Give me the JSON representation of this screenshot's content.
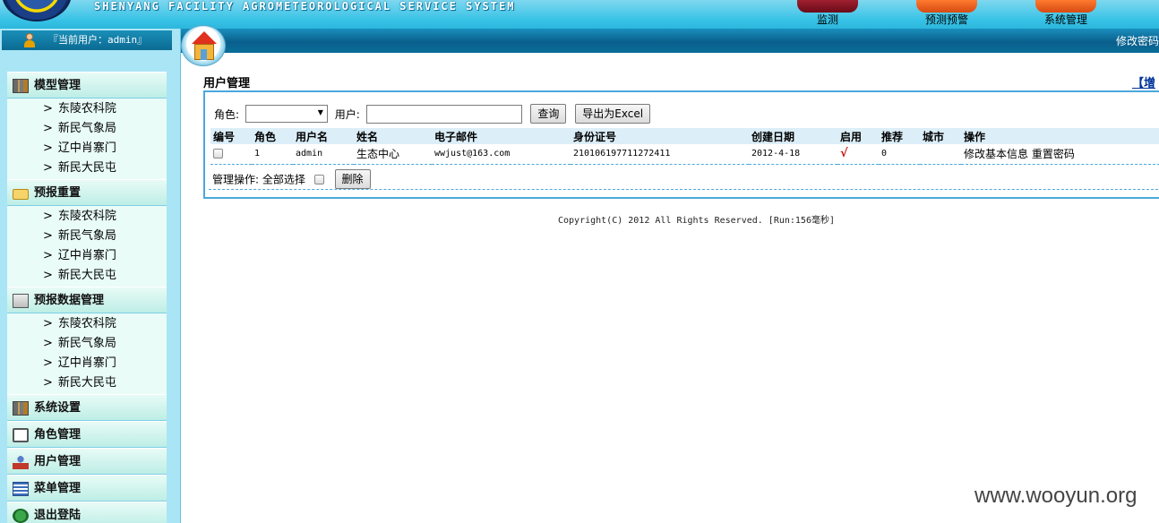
{
  "header": {
    "system_title": "SHENYANG FACILITY AGROMETEOROLOGICAL SERVICE SYSTEM",
    "nav": [
      {
        "label": "监测"
      },
      {
        "label": "预测预警"
      },
      {
        "label": "系统管理"
      }
    ]
  },
  "sidebar": {
    "current_user": "『当前用户：admin』",
    "groups": [
      {
        "title": "模型管理",
        "icon": "tools-icon",
        "items": [
          "东陵农科院",
          "新民气象局",
          "辽中肖寨门",
          "新民大民屯"
        ]
      },
      {
        "title": "预报重置",
        "icon": "folder-icon",
        "items": [
          "东陵农科院",
          "新民气象局",
          "辽中肖寨门",
          "新民大民屯"
        ]
      },
      {
        "title": "预报数据管理",
        "icon": "data-icon",
        "items": [
          "东陵农科院",
          "新民气象局",
          "辽中肖寨门",
          "新民大民屯"
        ]
      },
      {
        "title": "系统设置",
        "icon": "tools-icon",
        "items": []
      },
      {
        "title": "角色管理",
        "icon": "monitor-icon",
        "items": []
      },
      {
        "title": "用户管理",
        "icon": "person-icon",
        "items": []
      },
      {
        "title": "菜单管理",
        "icon": "list-icon",
        "items": []
      },
      {
        "title": "退出登陆",
        "icon": "exit-icon",
        "items": []
      }
    ]
  },
  "toolbar": {
    "change_password": "修改密码"
  },
  "main": {
    "title": "用户管理",
    "add_link": "【增"
  },
  "search": {
    "role_label": "角色:",
    "role_value": "",
    "user_label": "用户:",
    "user_value": "",
    "query_button": "查询",
    "export_button": "导出为Excel"
  },
  "table": {
    "headers": [
      "编号",
      "角色",
      "用户名",
      "姓名",
      "电子邮件",
      "身份证号",
      "创建日期",
      "启用",
      "推荐",
      "城市",
      "操作"
    ],
    "rows": [
      {
        "role": "1",
        "username": "admin",
        "name": "生态中心",
        "email": "wwjust@163.com",
        "id_number": "210106197711272411",
        "created": "2012-4-18",
        "enabled": "√",
        "recommend": "0",
        "city": "",
        "action_edit": "修改基本信息",
        "action_reset": "重置密码"
      }
    ]
  },
  "manage": {
    "label": "管理操作:",
    "select_all": "全部选择",
    "delete_button": "删除"
  },
  "footer": {
    "copyright": "Copyright(C) 2012 All Rights Reserved. [Run:156毫秒]"
  },
  "watermark": "www.wooyun.org"
}
